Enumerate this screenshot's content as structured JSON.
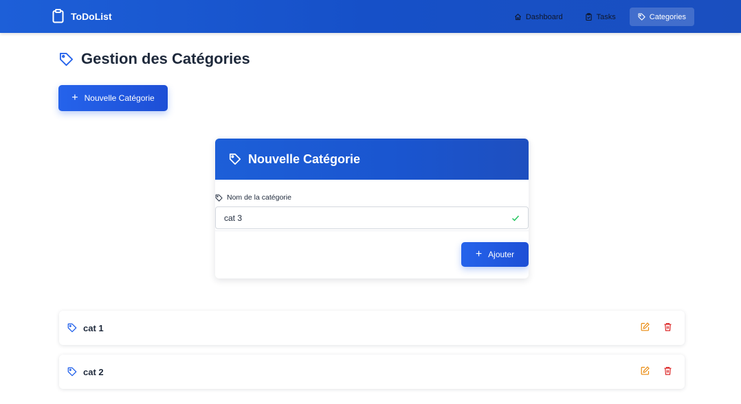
{
  "navbar": {
    "brand": "ToDoList",
    "links": [
      {
        "label": "Dashboard",
        "icon": "home-icon",
        "active": false
      },
      {
        "label": "Tasks",
        "icon": "clipboard-check-icon",
        "active": false
      },
      {
        "label": "Categories",
        "icon": "tag-icon",
        "active": true
      }
    ]
  },
  "page": {
    "title": "Gestion des Catégories",
    "new_button": "Nouvelle Catégorie"
  },
  "form": {
    "title": "Nouvelle Catégorie",
    "field_label": "Nom de la catégorie",
    "field_value": "cat 3",
    "submit_label": "Ajouter"
  },
  "categories": [
    {
      "name": "cat 1"
    },
    {
      "name": "cat 2"
    }
  ],
  "colors": {
    "primary": "#2563eb",
    "navbar": "#1d5fd8",
    "edit": "#ea8a0e",
    "delete": "#dc2626",
    "valid": "#22c55e"
  }
}
